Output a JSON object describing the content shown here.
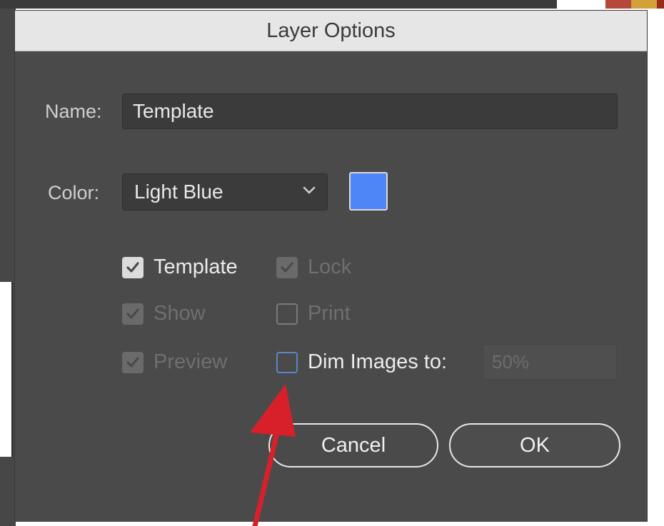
{
  "dialog": {
    "title": "Layer Options",
    "name_label": "Name:",
    "name_value": "Template",
    "color_label": "Color:",
    "color_value": "Light Blue",
    "swatch_color": "#4f86f7",
    "checkboxes": {
      "template": {
        "label": "Template",
        "checked": true,
        "enabled": true
      },
      "lock": {
        "label": "Lock",
        "checked": true,
        "enabled": false
      },
      "show": {
        "label": "Show",
        "checked": true,
        "enabled": false
      },
      "print": {
        "label": "Print",
        "checked": false,
        "enabled": false
      },
      "preview": {
        "label": "Preview",
        "checked": true,
        "enabled": false
      },
      "dim_images": {
        "label": "Dim Images to:",
        "checked": false,
        "enabled": true
      }
    },
    "dim_value": "50%",
    "cancel_label": "Cancel",
    "ok_label": "OK"
  },
  "annotation": {
    "arrow_color": "#d8202a"
  }
}
